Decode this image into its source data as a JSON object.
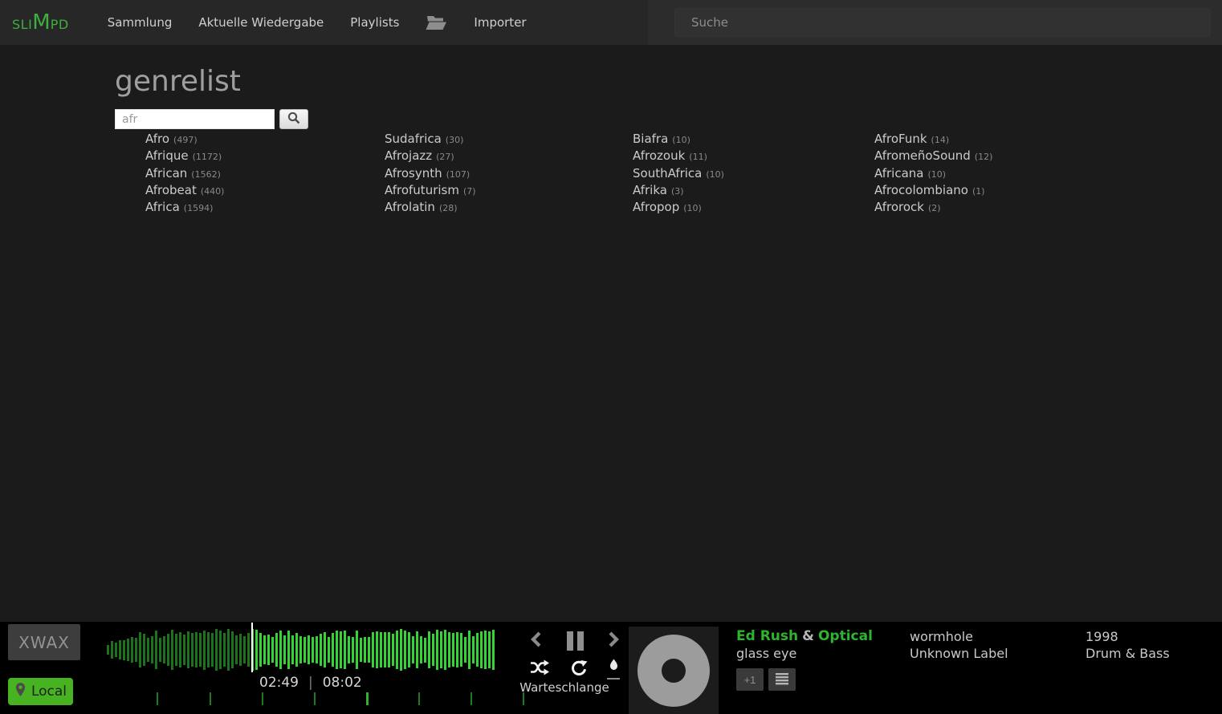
{
  "brand": {
    "prefix": "SLI",
    "mid": "M",
    "suffix": "PD"
  },
  "nav": {
    "items": [
      "Sammlung",
      "Aktuelle Wiedergabe",
      "Playlists",
      "Importer"
    ],
    "search_placeholder": "Suche"
  },
  "page": {
    "title": "genrelist",
    "filter_value": "afr"
  },
  "genre_columns": [
    {
      "items": [
        {
          "name": "Afro",
          "count": "(497)"
        },
        {
          "name": "Afrique",
          "count": "(1172)"
        },
        {
          "name": "African",
          "count": "(1562)"
        },
        {
          "name": "Afrobeat",
          "count": "(440)"
        },
        {
          "name": "Africa",
          "count": "(1594)"
        }
      ]
    },
    {
      "items": [
        {
          "name": "Sudafrica",
          "count": "(30)"
        },
        {
          "name": "Afrojazz",
          "count": "(27)"
        },
        {
          "name": "Afrosynth",
          "count": "(107)"
        },
        {
          "name": "Afrofuturism",
          "count": "(7)"
        },
        {
          "name": "Afrolatin",
          "count": "(28)"
        }
      ]
    },
    {
      "items": [
        {
          "name": "Biafra",
          "count": "(10)"
        },
        {
          "name": "Afrozouk",
          "count": "(11)"
        },
        {
          "name": "SouthAfrica",
          "count": "(10)"
        },
        {
          "name": "Afrika",
          "count": "(3)"
        },
        {
          "name": "Afropop",
          "count": "(10)"
        }
      ]
    },
    {
      "items": [
        {
          "name": "AfroFunk",
          "count": "(14)"
        },
        {
          "name": "AfromeñoSound",
          "count": "(12)"
        },
        {
          "name": "Africana",
          "count": "(10)"
        },
        {
          "name": "Afrocolombiano",
          "count": "(1)"
        },
        {
          "name": "Afrorock",
          "count": "(2)"
        }
      ]
    }
  ],
  "player": {
    "deck_label": "XWAX",
    "local_label": "Local",
    "elapsed": "02:49",
    "separator": "|",
    "duration": "08:02",
    "queue_label": "Warteschlange",
    "plus_one_label": "+1",
    "track": {
      "artist_a": "Ed Rush",
      "ampersand": "&",
      "artist_b": "Optical",
      "title": "glass eye",
      "album": "wormhole",
      "label": "Unknown Label",
      "year": "1998",
      "genre": "Drum & Bass"
    }
  },
  "colors": {
    "accent_green": "#3fae3f",
    "artist_green": "#2eb42e",
    "local_button_green": "#48b321",
    "waveform_remaining": "#35d335",
    "waveform_played": "#1d731d",
    "topbar_bg": "#272727",
    "player_bg": "#000000"
  }
}
